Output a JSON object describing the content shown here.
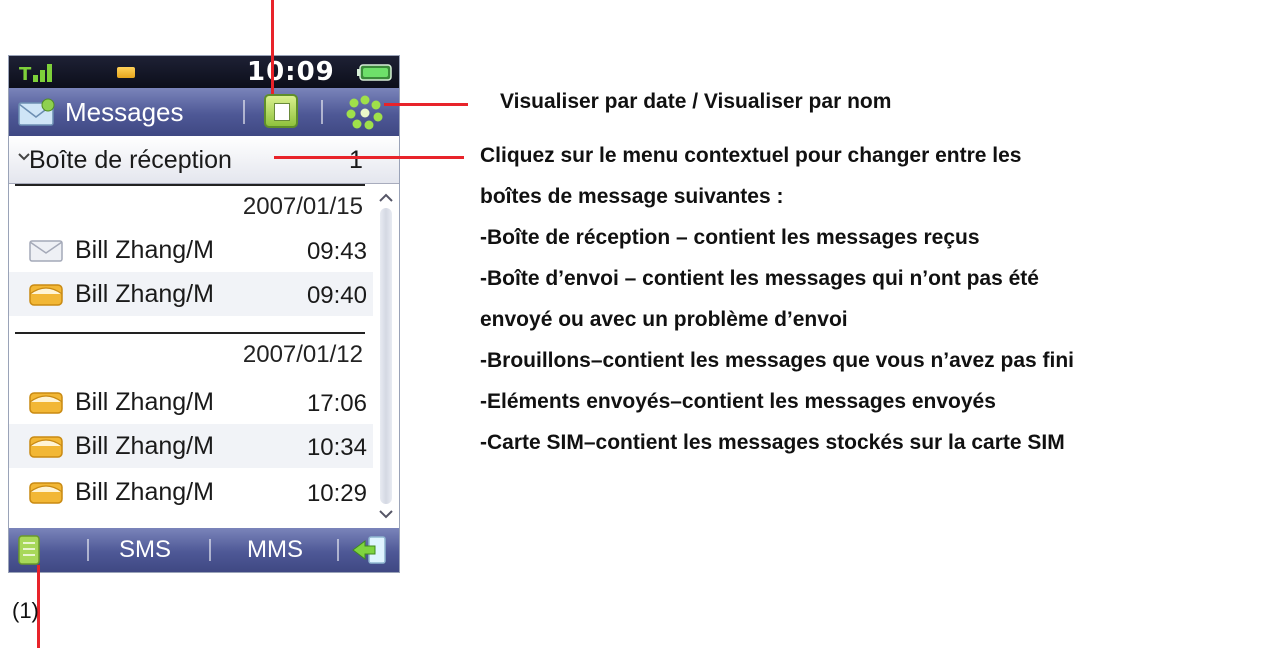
{
  "status_bar": {
    "time": "10:09"
  },
  "title_bar": {
    "title": "Messages"
  },
  "folder_dropdown": {
    "label": "Boîte de réception",
    "count": "1"
  },
  "message_groups": [
    {
      "date": "2007/01/15",
      "messages": [
        {
          "sender": "Bill Zhang/M",
          "time": "09:43",
          "icon": "envelope-read-icon"
        },
        {
          "sender": "Bill Zhang/M",
          "time": "09:40",
          "icon": "envelope-unread-icon"
        }
      ]
    },
    {
      "date": "2007/01/12",
      "messages": [
        {
          "sender": "Bill Zhang/M",
          "time": "17:06",
          "icon": "envelope-unread-icon"
        },
        {
          "sender": "Bill Zhang/M",
          "time": "10:34",
          "icon": "envelope-unread-icon"
        },
        {
          "sender": "Bill Zhang/M",
          "time": "10:29",
          "icon": "envelope-unread-icon"
        }
      ]
    }
  ],
  "bottom_bar": {
    "sms_label": "SMS",
    "mms_label": "MMS"
  },
  "annotations": {
    "view_toggle": "Visualiser par date / Visualiser par nom",
    "folder_lines": [
      "Cliquez sur le menu contextuel pour changer entre les",
      "boîtes de message suivantes :",
      "-Boîte de réception – contient les messages reçus",
      "-Boîte d’envoi – contient les messages qui n’ont pas été",
      "envoyé ou avec un problème d’envoi",
      "-Brouillons–contient les messages que vous n’avez pas fini",
      "-Eléments envoyés–contient les messages envoyés",
      "-Carte SIM–contient les messages stockés sur la carte SIM"
    ],
    "label_1": "(1)"
  },
  "colors": {
    "bar_accent": "#4e5896",
    "pointer": "#e8232a",
    "unread_envelope": "#f2b735"
  }
}
